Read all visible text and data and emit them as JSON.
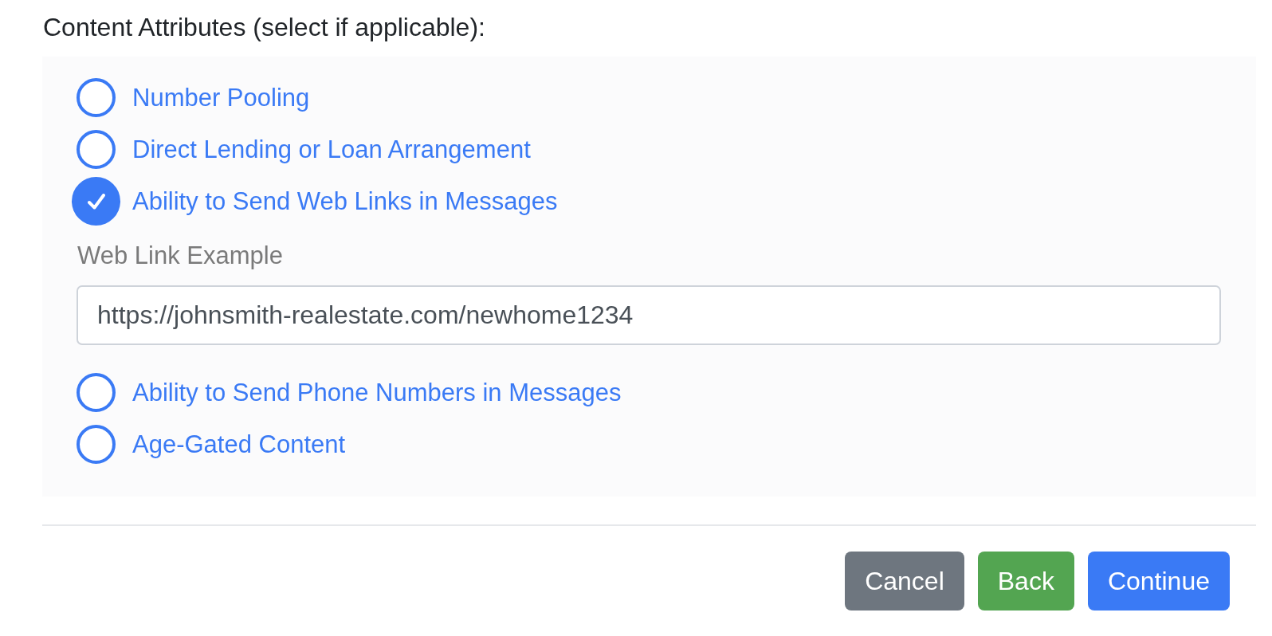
{
  "section": {
    "title": "Content Attributes (select if applicable):"
  },
  "attributes": [
    {
      "label": "Number Pooling",
      "checked": false
    },
    {
      "label": "Direct Lending or Loan Arrangement",
      "checked": false
    },
    {
      "label": "Ability to Send Web Links in Messages",
      "checked": true,
      "field": {
        "label": "Web Link Example",
        "value": "https://johnsmith-realestate.com/newhome1234"
      }
    },
    {
      "label": "Ability to Send Phone Numbers in Messages",
      "checked": false
    },
    {
      "label": "Age-Gated Content",
      "checked": false
    }
  ],
  "buttons": [
    {
      "label": "Cancel",
      "kind": "secondary"
    },
    {
      "label": "Back",
      "kind": "success"
    },
    {
      "label": "Continue",
      "kind": "primary"
    }
  ]
}
